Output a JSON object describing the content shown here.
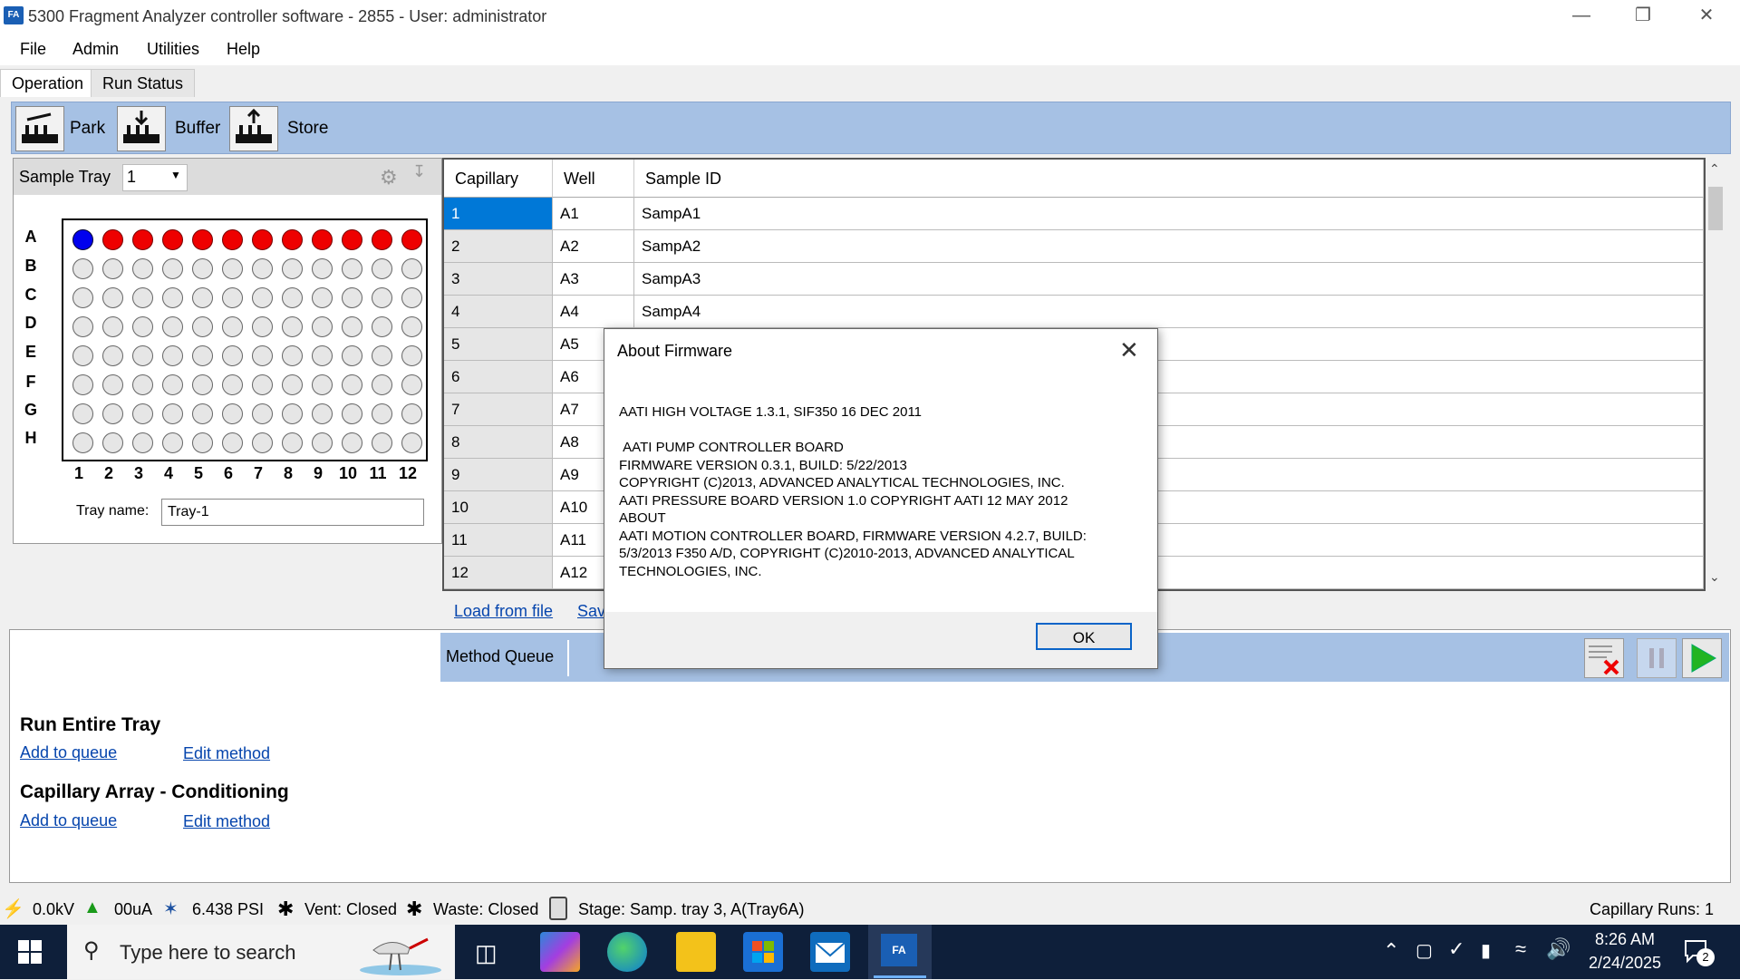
{
  "window": {
    "title": "5300 Fragment Analyzer controller software - 2855 - User: administrator",
    "app_icon_text": "FA"
  },
  "menubar": {
    "items": [
      "File",
      "Admin",
      "Utilities",
      "Help"
    ]
  },
  "tabs": {
    "items": [
      "Operation",
      "Run Status"
    ],
    "active": "Operation"
  },
  "toolbar": {
    "park": "Park",
    "buffer": "Buffer",
    "store": "Store"
  },
  "tray": {
    "label": "Sample Tray",
    "selected": "1",
    "row_labels": [
      "A",
      "B",
      "C",
      "D",
      "E",
      "F",
      "G",
      "H"
    ],
    "col_labels": [
      "1",
      "2",
      "3",
      "4",
      "5",
      "6",
      "7",
      "8",
      "9",
      "10",
      "11",
      "12"
    ],
    "tray_name_label": "Tray name:",
    "tray_name_value": "Tray-1",
    "well_states": {
      "A1": "blue",
      "A2-A12": "red",
      "others": "empty"
    },
    "colors": {
      "blue": "#0000ee",
      "red": "#ee0000",
      "empty": "#e6e6e6"
    }
  },
  "table": {
    "headers": [
      "Capillary",
      "Well",
      "Sample ID"
    ],
    "rows": [
      [
        "1",
        "A1",
        "SampA1"
      ],
      [
        "2",
        "A2",
        "SampA2"
      ],
      [
        "3",
        "A3",
        "SampA3"
      ],
      [
        "4",
        "A4",
        "SampA4"
      ],
      [
        "5",
        "A5",
        ""
      ],
      [
        "6",
        "A6",
        ""
      ],
      [
        "7",
        "A7",
        ""
      ],
      [
        "8",
        "A8",
        ""
      ],
      [
        "9",
        "A9",
        ""
      ],
      [
        "10",
        "A10",
        ""
      ],
      [
        "11",
        "A11",
        ""
      ],
      [
        "12",
        "A12",
        ""
      ]
    ],
    "load_link": "Load from file",
    "save_link": "Sav"
  },
  "methods": {
    "queue_label": "Method Queue",
    "groups": [
      {
        "title": "Run Entire Tray",
        "add": "Add to queue",
        "edit": "Edit method"
      },
      {
        "title": "Capillary Array - Conditioning",
        "add": "Add to queue",
        "edit": "Edit method"
      }
    ]
  },
  "status": {
    "kv": "0.0kV",
    "ua": "00uA",
    "psi": "6.438 PSI",
    "vent": "Vent: Closed",
    "waste": "Waste: Closed",
    "stage": "Stage: Samp. tray 3, A(Tray6A)",
    "runs": "Capillary Runs: 1"
  },
  "dialog": {
    "title": "About Firmware",
    "body": "AATI HIGH VOLTAGE 1.3.1, SIF350 16 DEC 2011\n\n AATI PUMP CONTROLLER BOARD\nFIRMWARE VERSION 0.3.1, BUILD: 5/22/2013\nCOPYRIGHT (C)2013, ADVANCED ANALYTICAL TECHNOLOGIES, INC.\nAATI PRESSURE BOARD VERSION 1.0 COPYRIGHT AATI 12 MAY 2012\nABOUT\nAATI MOTION CONTROLLER BOARD, FIRMWARE VERSION 4.2.7, BUILD:\n5/3/2013 F350 A/D, COPYRIGHT (C)2010-2013, ADVANCED ANALYTICAL\nTECHNOLOGIES, INC.",
    "ok": "OK"
  },
  "taskbar": {
    "search_placeholder": "Type here to search",
    "time": "8:26 AM",
    "date": "2/24/2025",
    "notification_count": "2"
  }
}
